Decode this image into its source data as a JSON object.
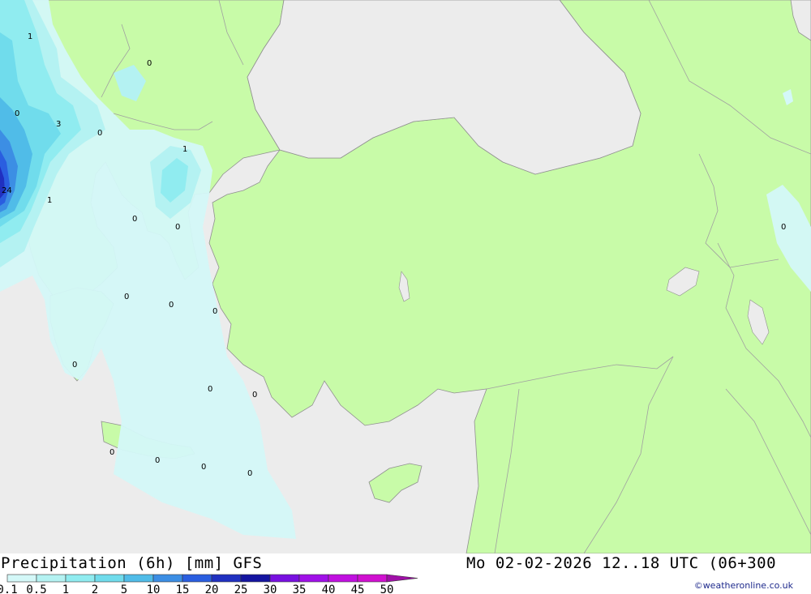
{
  "title": "Precipitation (6h) [mm] GFS",
  "valid_time": "Mo 02-02-2026 12..18 UTC (06+300",
  "credit": "©weatheronline.co.uk",
  "colors": {
    "sea": "#ececec",
    "land": "#c8fba8",
    "border": "#a0a0a0",
    "coast": "#909090"
  },
  "legend": {
    "ticks": [
      "0.1",
      "0.5",
      "1",
      "2",
      "5",
      "10",
      "15",
      "20",
      "25",
      "30",
      "35",
      "40",
      "45",
      "50"
    ],
    "colors": [
      "#d4f8f8",
      "#b4f2f2",
      "#90ecf0",
      "#70dcec",
      "#50bce8",
      "#3c8ee4",
      "#2a5ee0",
      "#2030c0",
      "#1414a0",
      "#7810e0",
      "#a010e8",
      "#c010e0",
      "#d010d0",
      "#a010a8"
    ]
  },
  "contour_labels": [
    "1",
    "0",
    "0",
    "3",
    "0",
    "24",
    "1",
    "1",
    "0",
    "0",
    "0",
    "0",
    "0",
    "0",
    "0",
    "0",
    "0",
    "0",
    "0",
    "0",
    "0"
  ]
}
